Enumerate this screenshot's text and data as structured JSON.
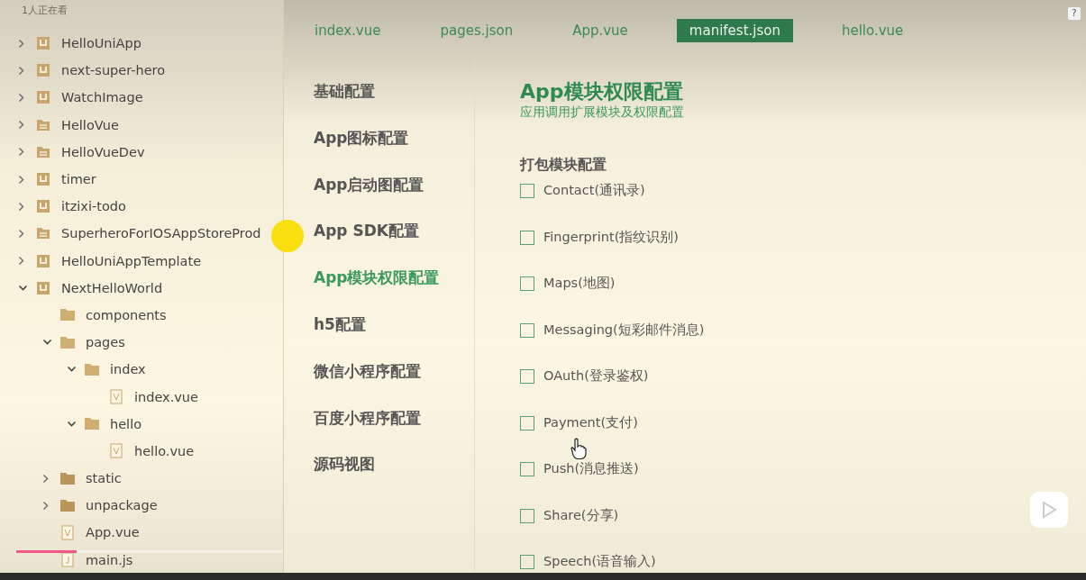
{
  "viewer_count": "1人正在看",
  "help_label": "?",
  "tree": [
    {
      "label": "HelloUniApp",
      "kind": "project",
      "collapsible": true,
      "expanded": false
    },
    {
      "label": "next-super-hero",
      "kind": "project",
      "collapsible": true,
      "expanded": false
    },
    {
      "label": "WatchImage",
      "kind": "project",
      "collapsible": true,
      "expanded": false
    },
    {
      "label": "HelloVue",
      "kind": "web-project",
      "collapsible": true,
      "expanded": false
    },
    {
      "label": "HelloVueDev",
      "kind": "web-project",
      "collapsible": true,
      "expanded": false
    },
    {
      "label": "timer",
      "kind": "project",
      "collapsible": true,
      "expanded": false
    },
    {
      "label": "itzixi-todo",
      "kind": "project",
      "collapsible": true,
      "expanded": false
    },
    {
      "label": "SuperheroForIOSAppStoreProd",
      "kind": "web-project",
      "collapsible": true,
      "expanded": false
    },
    {
      "label": "HelloUniAppTemplate",
      "kind": "project",
      "collapsible": true,
      "expanded": false
    },
    {
      "label": "NextHelloWorld",
      "kind": "project",
      "collapsible": true,
      "expanded": true,
      "children": [
        {
          "label": "components",
          "kind": "folder-open",
          "collapsible": false
        },
        {
          "label": "pages",
          "kind": "folder-open",
          "collapsible": true,
          "expanded": true,
          "children": [
            {
              "label": "index",
              "kind": "folder-open",
              "collapsible": true,
              "expanded": true,
              "children": [
                {
                  "label": "index.vue",
                  "kind": "vue",
                  "collapsible": false
                }
              ]
            },
            {
              "label": "hello",
              "kind": "folder-open",
              "collapsible": true,
              "expanded": true,
              "children": [
                {
                  "label": "hello.vue",
                  "kind": "vue",
                  "collapsible": false
                }
              ]
            }
          ]
        },
        {
          "label": "static",
          "kind": "folder",
          "collapsible": true,
          "expanded": false
        },
        {
          "label": "unpackage",
          "kind": "folder",
          "collapsible": true,
          "expanded": false
        },
        {
          "label": "App.vue",
          "kind": "vue",
          "collapsible": false
        },
        {
          "label": "main.js",
          "kind": "js",
          "collapsible": false
        }
      ]
    }
  ],
  "tabs": [
    {
      "label": "index.vue",
      "selected": false
    },
    {
      "label": "pages.json",
      "selected": false
    },
    {
      "label": "App.vue",
      "selected": false
    },
    {
      "label": "manifest.json",
      "selected": true
    },
    {
      "label": "hello.vue",
      "selected": false
    }
  ],
  "nav": [
    {
      "label": "基础配置",
      "selected": false
    },
    {
      "label": "App图标配置",
      "selected": false
    },
    {
      "label": "App启动图配置",
      "selected": false
    },
    {
      "label": "App SDK配置",
      "selected": false
    },
    {
      "label": "App模块权限配置",
      "selected": true
    },
    {
      "label": "h5配置",
      "selected": false
    },
    {
      "label": "微信小程序配置",
      "selected": false
    },
    {
      "label": "百度小程序配置",
      "selected": false
    },
    {
      "label": "源码视图",
      "selected": false
    }
  ],
  "content": {
    "title": "App模块权限配置",
    "subtitle": "应用调用扩展模块及权限配置",
    "section": "打包模块配置",
    "modules": [
      {
        "label": "Contact(通讯录)",
        "checked": false
      },
      {
        "label": "Fingerprint(指纹识别)",
        "checked": false
      },
      {
        "label": "Maps(地图)",
        "checked": false
      },
      {
        "label": "Messaging(短彩邮件消息)",
        "checked": false
      },
      {
        "label": "OAuth(登录鉴权)",
        "checked": false
      },
      {
        "label": "Payment(支付)",
        "checked": false
      },
      {
        "label": "Push(消息推送)",
        "checked": false
      },
      {
        "label": "Share(分享)",
        "checked": false
      },
      {
        "label": "Speech(语音输入)",
        "checked": false
      }
    ]
  },
  "video_progress": {
    "level": 0.21
  }
}
